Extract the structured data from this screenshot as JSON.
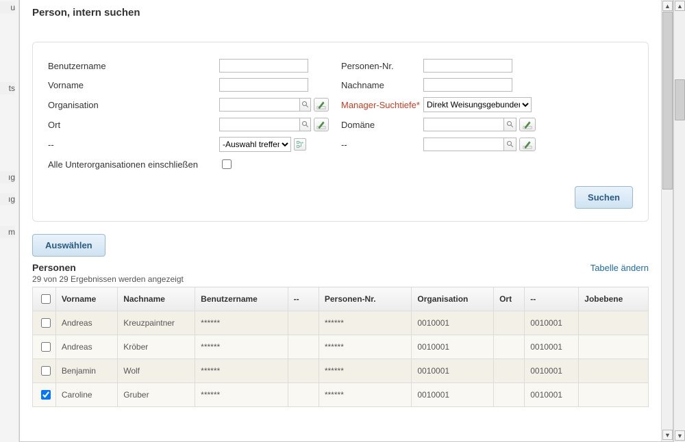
{
  "title": "Person, intern suchen",
  "filters": {
    "benutzername_label": "Benutzername",
    "personen_nr_label": "Personen-Nr.",
    "vorname_label": "Vorname",
    "nachname_label": "Nachname",
    "organisation_label": "Organisation",
    "manager_suchtiefe_label": "Manager-Suchtiefe*",
    "manager_suchtiefe_value": "Direkt Weisungsgebundener",
    "ort_label": "Ort",
    "domaene_label": "Domäne",
    "dash_label": "--",
    "auswahl_treffen": "-Auswahl treffen-",
    "alle_unterorg_label": "Alle Unterorganisationen einschließen"
  },
  "buttons": {
    "suchen": "Suchen",
    "auswaehlen": "Auswählen"
  },
  "results": {
    "section_title": "Personen",
    "change_table": "Tabelle ändern",
    "count_text": "29 von 29 Ergebnissen werden angezeigt",
    "headers": {
      "vorname": "Vorname",
      "nachname": "Nachname",
      "benutzername": "Benutzername",
      "dash1": "--",
      "personen_nr": "Personen-Nr.",
      "organisation": "Organisation",
      "ort": "Ort",
      "dash2": "--",
      "jobebene": "Jobebene"
    },
    "rows": [
      {
        "checked": false,
        "vorname": "Andreas",
        "nachname": "Kreuzpaintner",
        "benutzername": "******",
        "dash1": "",
        "personen_nr": "******",
        "organisation": "0010001",
        "ort": "",
        "dash2": "0010001",
        "jobebene": ""
      },
      {
        "checked": false,
        "vorname": "Andreas",
        "nachname": "Kröber",
        "benutzername": "******",
        "dash1": "",
        "personen_nr": "******",
        "organisation": "0010001",
        "ort": "",
        "dash2": "0010001",
        "jobebene": ""
      },
      {
        "checked": false,
        "vorname": "Benjamin",
        "nachname": "Wolf",
        "benutzername": "******",
        "dash1": "",
        "personen_nr": "******",
        "organisation": "0010001",
        "ort": "",
        "dash2": "0010001",
        "jobebene": ""
      },
      {
        "checked": true,
        "vorname": "Caroline",
        "nachname": "Gruber",
        "benutzername": "******",
        "dash1": "",
        "personen_nr": "******",
        "organisation": "0010001",
        "ort": "",
        "dash2": "0010001",
        "jobebene": ""
      }
    ]
  }
}
